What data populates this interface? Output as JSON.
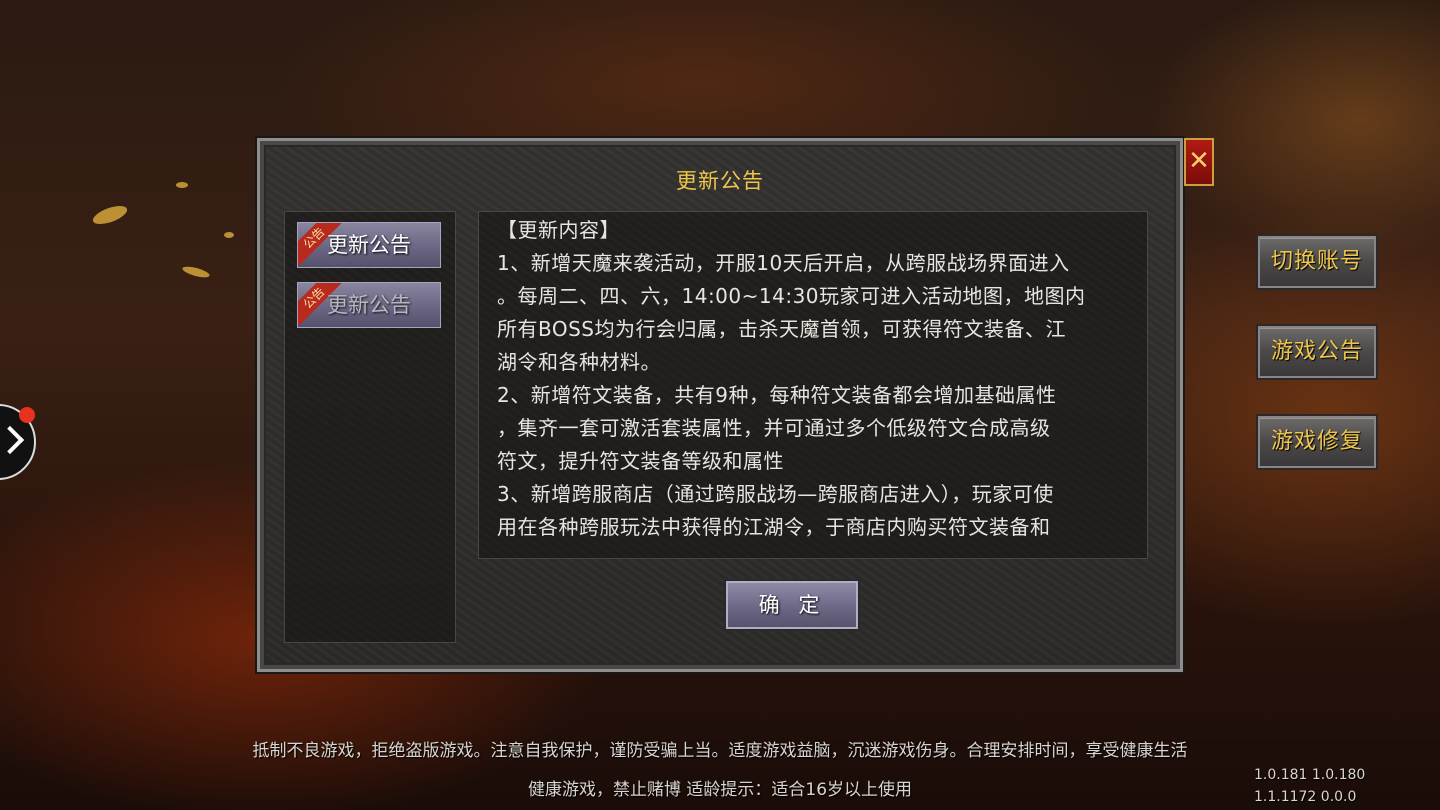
{
  "dialog": {
    "title": "更新公告",
    "close_symbol": "✕",
    "tabs": [
      {
        "badge": "公告",
        "label": "更新公告",
        "active": true
      },
      {
        "badge": "公告",
        "label": "更新公告",
        "active": false
      }
    ],
    "content_lines": [
      "【更新内容】",
      "1、新增天魔来袭活动，开服10天后开启，从跨服战场界面进入",
      "。每周二、四、六，14:00~14:30玩家可进入活动地图，地图内",
      "所有BOSS均为行会归属，击杀天魔首领，可获得符文装备、江",
      "湖令和各种材料。",
      "2、新增符文装备，共有9种，每种符文装备都会增加基础属性",
      "，集齐一套可激活套装属性，并可通过多个低级符文合成高级",
      "符文，提升符文装备等级和属性",
      "3、新增跨服商店（通过跨服战场—跨服商店进入），玩家可使",
      "用在各种跨服玩法中获得的江湖令，于商店内购买符文装备和"
    ],
    "confirm_label": "确 定"
  },
  "side_buttons": {
    "switch_account": "切换账号",
    "game_notice": "游戏公告",
    "game_repair": "游戏修复"
  },
  "footer": {
    "line1": "抵制不良游戏，拒绝盗版游戏。注意自我保护，谨防受骗上当。适度游戏益脑，沉迷游戏伤身。合理安排时间，享受健康生活",
    "line2": "健康游戏，禁止赌博  适龄提示：适合16岁以上使用"
  },
  "version": {
    "line1": "1.0.181  1.0.180",
    "line2": "1.1.1172  0.0.0"
  },
  "colors": {
    "gold_text": "#f0c64a",
    "close_red": "#b21a14",
    "notification_dot": "#e8321e"
  }
}
